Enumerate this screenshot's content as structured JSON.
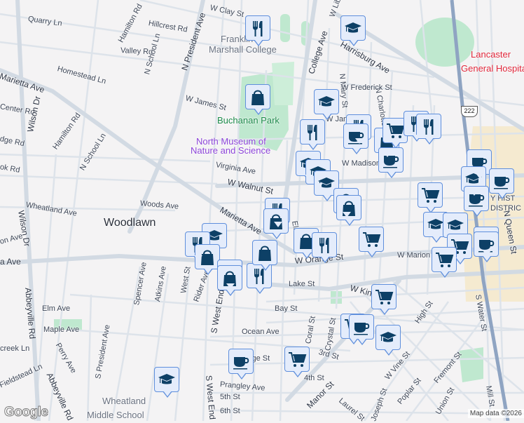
{
  "map": {
    "attribution": "Map data ©2026",
    "logo": "Google",
    "route_shield": "222",
    "colors": {
      "pin_bg": "#e4ecfb",
      "pin_border": "#5f8fdc",
      "pin_icon": "#0d4066",
      "park": "#b9e6c9",
      "road": "#d3dbe3",
      "highway": "#8fa4c2"
    }
  },
  "labels": [
    {
      "text": "Quarry Ln",
      "kind": "street"
    },
    {
      "text": "Hillcrest Rd",
      "kind": "street"
    },
    {
      "text": "Hamilton Rd",
      "kind": "street"
    },
    {
      "text": "W Clay St",
      "kind": "street"
    },
    {
      "text": "N President Ave",
      "kind": "main"
    },
    {
      "text": "Valley Rd",
      "kind": "street"
    },
    {
      "text": "N School Ln",
      "kind": "street"
    },
    {
      "text": "Homestead Ln",
      "kind": "street"
    },
    {
      "text": "Marietta Ave",
      "kind": "main"
    },
    {
      "text": "Center Rd",
      "kind": "street"
    },
    {
      "text": "Wilson Dr",
      "kind": "main"
    },
    {
      "text": "Hamilton Rd",
      "kind": "street"
    },
    {
      "text": "N School Ln",
      "kind": "street"
    },
    {
      "text": "dge Rd",
      "kind": "street"
    },
    {
      "text": "ok Rd",
      "kind": "street"
    },
    {
      "text": "W James St",
      "kind": "street"
    },
    {
      "text": "Buchanan Park",
      "kind": "poi-green"
    },
    {
      "text": "North Museum of",
      "kind": "poi-purple"
    },
    {
      "text": "Nature and Science",
      "kind": "poi-purple"
    },
    {
      "text": "Virginia Ave",
      "kind": "street"
    },
    {
      "text": "W Walnut St",
      "kind": "main"
    },
    {
      "text": "Wheatland Ave",
      "kind": "street"
    },
    {
      "text": "Woods Ave",
      "kind": "street"
    },
    {
      "text": "Marietta Ave",
      "kind": "main"
    },
    {
      "text": "Woodlawn",
      "kind": "big"
    },
    {
      "text": "Franklin &",
      "kind": "poi-gray"
    },
    {
      "text": "Marshall College",
      "kind": "poi-gray"
    },
    {
      "text": "College Ave",
      "kind": "main"
    },
    {
      "text": "W Liberty St",
      "kind": "street"
    },
    {
      "text": "Harrisburg Ave",
      "kind": "main"
    },
    {
      "text": "N Mary St",
      "kind": "street"
    },
    {
      "text": "N Charlotte St",
      "kind": "street"
    },
    {
      "text": "W Frederick St",
      "kind": "street"
    },
    {
      "text": "W James St",
      "kind": "street"
    },
    {
      "text": "W Madison St",
      "kind": "street"
    },
    {
      "text": "Lancaster",
      "kind": "poi-red"
    },
    {
      "text": "General Hospital",
      "kind": "poi-red"
    },
    {
      "text": "Elm St",
      "kind": "street"
    },
    {
      "text": "W Orange St",
      "kind": "main"
    },
    {
      "text": "Lake St",
      "kind": "street"
    },
    {
      "text": "W King St",
      "kind": "main"
    },
    {
      "text": "Bay St",
      "kind": "street"
    },
    {
      "text": "Coral St",
      "kind": "street"
    },
    {
      "text": "Crystal St",
      "kind": "street"
    },
    {
      "text": "Ocean Ave",
      "kind": "street"
    },
    {
      "text": "3rd St",
      "kind": "street"
    },
    {
      "text": "Manor St",
      "kind": "main"
    },
    {
      "text": "George St",
      "kind": "street"
    },
    {
      "text": "4th St",
      "kind": "street"
    },
    {
      "text": "Laurel St",
      "kind": "street"
    },
    {
      "text": "Joseph St",
      "kind": "street"
    },
    {
      "text": "W Vine St",
      "kind": "street"
    },
    {
      "text": "Poplar St",
      "kind": "street"
    },
    {
      "text": "Fremont St",
      "kind": "street"
    },
    {
      "text": "Union St",
      "kind": "street"
    },
    {
      "text": "High St",
      "kind": "street"
    },
    {
      "text": "S Water St",
      "kind": "street"
    },
    {
      "text": "N Queen St",
      "kind": "main"
    },
    {
      "text": "Mill St",
      "kind": "street"
    },
    {
      "text": "W Marion St",
      "kind": "street"
    },
    {
      "text": "Elm Ave",
      "kind": "street"
    },
    {
      "text": "Maple Ave",
      "kind": "street"
    },
    {
      "text": "Spencer Ave",
      "kind": "street"
    },
    {
      "text": "Atkins Ave",
      "kind": "street"
    },
    {
      "text": "West St",
      "kind": "street"
    },
    {
      "text": "Rider Ave",
      "kind": "street"
    },
    {
      "text": "S West End Ave",
      "kind": "main"
    },
    {
      "text": "S West End",
      "kind": "main"
    },
    {
      "text": "S President Ave",
      "kind": "street"
    },
    {
      "text": "Abbeyville Rd",
      "kind": "main"
    },
    {
      "text": "Abbeyville Rd",
      "kind": "main"
    },
    {
      "text": "Wilson Dr",
      "kind": "main"
    },
    {
      "text": "Perry Ave",
      "kind": "street"
    },
    {
      "text": "creek Ln",
      "kind": "street"
    },
    {
      "text": "Fieldstead Ln",
      "kind": "street"
    },
    {
      "text": "Prangley Ave",
      "kind": "street"
    },
    {
      "text": "5th St",
      "kind": "street"
    },
    {
      "text": "6th St",
      "kind": "street"
    },
    {
      "text": "Wheatland",
      "kind": "poi-gray"
    },
    {
      "text": "Middle School",
      "kind": "poi-gray"
    },
    {
      "text": "on Ave",
      "kind": "street"
    },
    {
      "text": "a Ave",
      "kind": "main"
    },
    {
      "text": "Y HIST",
      "kind": "street"
    },
    {
      "text": "DISTRIC",
      "kind": "street"
    }
  ],
  "pins": [
    {
      "type": "restaurant"
    },
    {
      "type": "education"
    },
    {
      "type": "shopping"
    },
    {
      "type": "education"
    },
    {
      "type": "restaurant"
    },
    {
      "type": "restaurant"
    },
    {
      "type": "cafe"
    },
    {
      "type": "shopping"
    },
    {
      "type": "grocery"
    },
    {
      "type": "restaurant"
    },
    {
      "type": "restaurant"
    },
    {
      "type": "cafe"
    },
    {
      "type": "education"
    },
    {
      "type": "education"
    },
    {
      "type": "education"
    },
    {
      "type": "shopping"
    },
    {
      "type": "shopping"
    },
    {
      "type": "cafe"
    },
    {
      "type": "education"
    },
    {
      "type": "cafe"
    },
    {
      "type": "cafe"
    },
    {
      "type": "grocery"
    },
    {
      "type": "restaurant"
    },
    {
      "type": "shopping"
    },
    {
      "type": "education"
    },
    {
      "type": "restaurant"
    },
    {
      "type": "shopping"
    },
    {
      "type": "shopping"
    },
    {
      "type": "shopping"
    },
    {
      "type": "restaurant"
    },
    {
      "type": "shopping"
    },
    {
      "type": "shopping"
    },
    {
      "type": "restaurant"
    },
    {
      "type": "grocery"
    },
    {
      "type": "education"
    },
    {
      "type": "education"
    },
    {
      "type": "grocery"
    },
    {
      "type": "grocery"
    },
    {
      "type": "cafe"
    },
    {
      "type": "cafe"
    },
    {
      "type": "grocery"
    },
    {
      "type": "grocery"
    },
    {
      "type": "cafe"
    },
    {
      "type": "education"
    },
    {
      "type": "grocery"
    },
    {
      "type": "cafe"
    },
    {
      "type": "education"
    }
  ]
}
